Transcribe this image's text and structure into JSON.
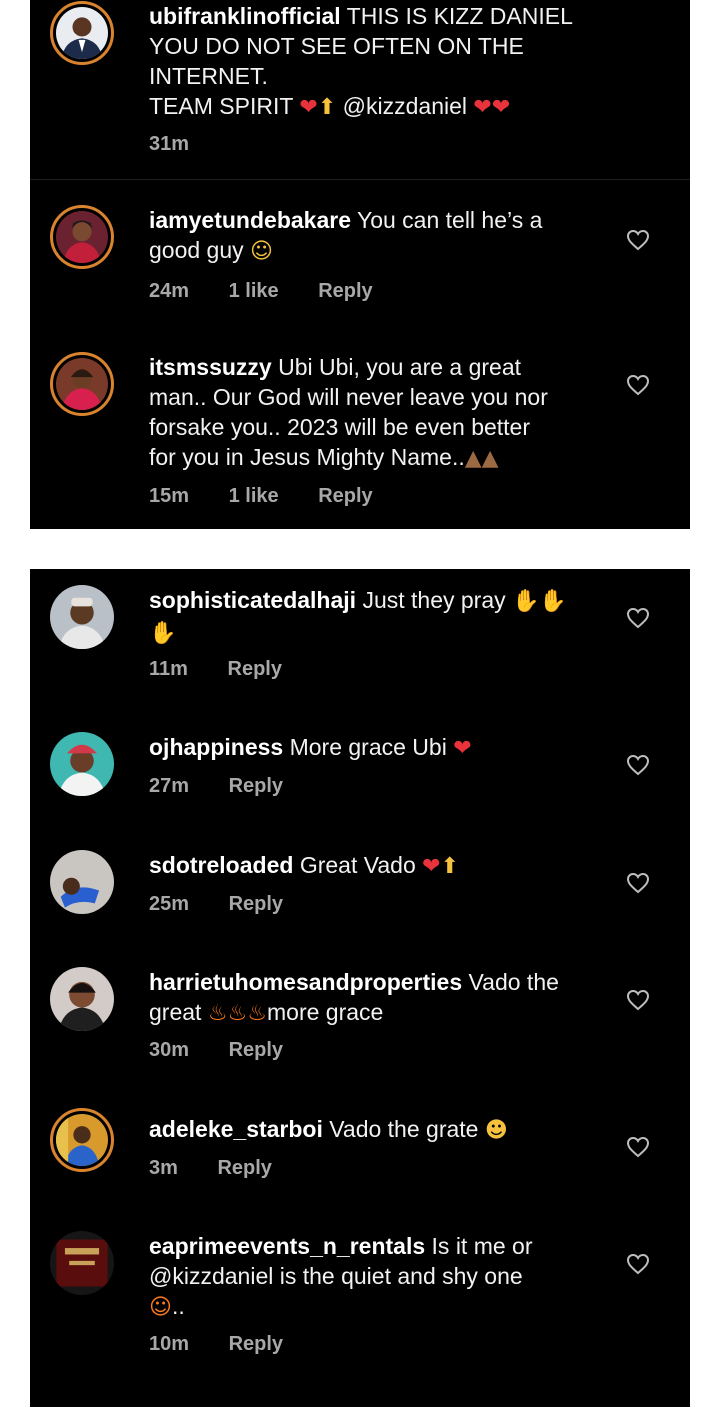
{
  "comments_top": [
    {
      "user": "ubifranklinofficial",
      "text_lines": [
        "THIS IS KIZZ DANIEL",
        "YOU DO NOT SEE OFTEN ON THE",
        "INTERNET.",
        "TEAM SPIRIT"
      ],
      "mention": "@kizzdaniel",
      "time": "31m"
    },
    {
      "user": "iamyetundebakare",
      "text_lines": [
        "You can tell he’s a",
        "good guy"
      ],
      "time": "24m",
      "likes": "1 like",
      "reply": "Reply"
    },
    {
      "user": "itsmssuzzy",
      "text_lines": [
        "Ubi Ubi, you are a great",
        "man.. Our God will never leave you nor",
        "forsake you.. 2023 will be even better",
        "for you in Jesus Mighty Name.."
      ],
      "time": "15m",
      "likes": "1 like",
      "reply": "Reply"
    }
  ],
  "comments_bottom": [
    {
      "user": "sophisticatedalhaji",
      "text": "Just they pray",
      "time": "11m",
      "reply": "Reply"
    },
    {
      "user": "ojhappiness",
      "text": "More grace Ubi",
      "time": "27m",
      "reply": "Reply"
    },
    {
      "user": "sdotreloaded",
      "text": "Great Vado",
      "time": "25m",
      "reply": "Reply"
    },
    {
      "user": "harrietuhomesandproperties",
      "text_a": "Vado the",
      "text_b": "great",
      "text_c": "more grace",
      "time": "30m",
      "reply": "Reply"
    },
    {
      "user": "adeleke_starboi",
      "text": "Vado the grate",
      "time": "3m",
      "reply": "Reply"
    },
    {
      "user": "eaprimeevents_n_rentals",
      "text_a": "Is it me or",
      "text_b": "@kizzdaniel is the quiet and shy one",
      "text_c": "..",
      "time": "10m",
      "reply": "Reply"
    }
  ],
  "icons": {
    "like": "heart-outline-icon",
    "emoji": [
      "red-heart",
      "folded-hands",
      "smiling-face",
      "clapping-hands",
      "fire",
      "heart-eyes",
      "shrug"
    ]
  },
  "colors": {
    "background": "#000000",
    "text": "#f2f2f2",
    "meta": "#a8a8a8",
    "story_ring": "#d8832e",
    "heart_emoji": "#e8323c"
  }
}
